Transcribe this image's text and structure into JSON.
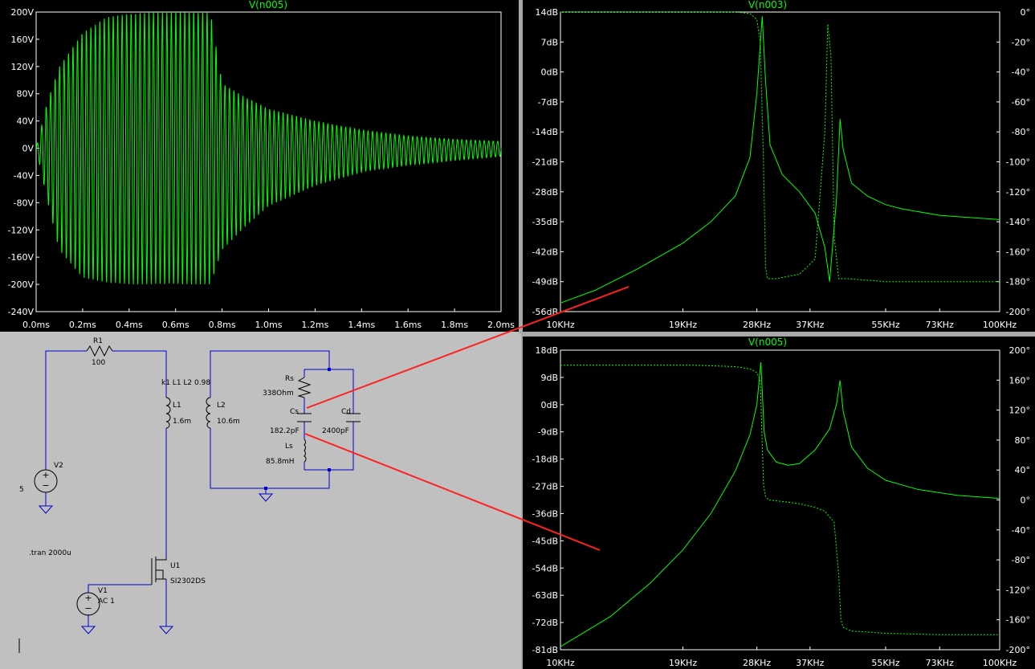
{
  "colors": {
    "trace": "#00ff00",
    "plot_bg": "#000000",
    "axis_text": "#ffffff",
    "grid": "#606060",
    "wire": "#0000cc",
    "schematic_bg": "#c0c0c0",
    "annotation": "#ff2020"
  },
  "plots": {
    "transient": {
      "title": "V(n005)",
      "y_ticks": [
        "200V",
        "160V",
        "120V",
        "80V",
        "40V",
        "0V",
        "-40V",
        "-80V",
        "-120V",
        "-160V",
        "-200V",
        "-240V"
      ],
      "x_ticks": [
        "0.0ms",
        "0.2ms",
        "0.4ms",
        "0.6ms",
        "0.8ms",
        "1.0ms",
        "1.2ms",
        "1.4ms",
        "1.6ms",
        "1.8ms",
        "2.0ms"
      ]
    },
    "ac_top": {
      "title": "V(n003)",
      "y_ticks": [
        "14dB",
        "7dB",
        "0dB",
        "-7dB",
        "-14dB",
        "-21dB",
        "-28dB",
        "-35dB",
        "-42dB",
        "-49dB",
        "-56dB"
      ],
      "y2_ticks": [
        "0°",
        "-20°",
        "-40°",
        "-60°",
        "-80°",
        "-100°",
        "-120°",
        "-140°",
        "-160°",
        "-180°",
        "-200°"
      ],
      "x_ticks": [
        "10KHz",
        "19KHz",
        "28KHz",
        "37KHz",
        "55KHz",
        "73KHz",
        "100KHz"
      ]
    },
    "ac_bottom": {
      "title": "V(n005)",
      "y_ticks": [
        "18dB",
        "9dB",
        "0dB",
        "-9dB",
        "-18dB",
        "-27dB",
        "-36dB",
        "-45dB",
        "-54dB",
        "-63dB",
        "-72dB",
        "-81dB"
      ],
      "y2_ticks": [
        "200°",
        "160°",
        "120°",
        "80°",
        "40°",
        "0°",
        "-40°",
        "-80°",
        "-120°",
        "-160°",
        "-200°"
      ],
      "x_ticks": [
        "10KHz",
        "19KHz",
        "28KHz",
        "37KHz",
        "55KHz",
        "73KHz",
        "100KHz"
      ]
    }
  },
  "chart_data": [
    {
      "type": "line",
      "title": "V(n005)",
      "xlabel": "",
      "ylabel": "",
      "xlim": [
        0.0,
        2.0
      ],
      "x_unit": "ms",
      "ylim": [
        -240,
        200
      ],
      "y_unit": "V",
      "series": [
        {
          "values_note_free": true,
          "x": [
            0.0,
            0.05,
            0.1,
            0.2,
            0.3,
            0.4,
            0.5,
            0.6,
            0.7,
            0.75,
            0.8,
            0.9,
            1.0,
            1.2,
            1.4,
            1.6,
            1.8,
            2.0
          ],
          "envelope_pos": [
            0,
            70,
            120,
            170,
            192,
            198,
            200,
            200,
            200,
            200,
            95,
            75,
            58,
            40,
            27,
            18,
            13,
            10
          ],
          "envelope_neg": [
            0,
            -80,
            -150,
            -190,
            -198,
            -200,
            -200,
            -200,
            -200,
            -200,
            -150,
            -115,
            -85,
            -55,
            -35,
            -25,
            -18,
            -12
          ]
        }
      ]
    },
    {
      "type": "line",
      "title": "V(n003)",
      "xlabel": "",
      "ylabel": "",
      "x_scale": "log",
      "xlim": [
        10,
        100
      ],
      "x_unit": "KHz",
      "ylim": [
        -56,
        14
      ],
      "y_unit": "dB",
      "y2lim": [
        -200,
        0
      ],
      "y2_unit": "°",
      "series": [
        {
          "x": [
            10,
            12,
            15,
            19,
            22,
            25,
            27,
            28,
            28.8,
            29.3,
            30,
            32,
            35,
            38,
            40,
            41,
            42.5,
            43.3,
            44,
            46,
            50,
            55,
            60,
            73,
            85,
            100
          ],
          "values": [
            -54,
            -51,
            -46,
            -40,
            -35,
            -29,
            -20,
            -5,
            13,
            -2,
            -17,
            -24,
            -28,
            -33,
            -41,
            -49,
            -30,
            -11,
            -18,
            -26,
            -29,
            -31,
            -32,
            -33.5,
            -34,
            -34.5
          ]
        },
        {
          "x": [
            10,
            20,
            25,
            27,
            28,
            28.5,
            29,
            29.3,
            29.6,
            31,
            35,
            38,
            40,
            40.6,
            41.3,
            42,
            43,
            45,
            55,
            73,
            100
          ],
          "values": [
            0,
            0,
            0,
            -1,
            -5,
            -20,
            -100,
            -170,
            -178,
            -178,
            -175,
            -165,
            -80,
            -8,
            -30,
            -150,
            -178,
            -178,
            -180,
            -180,
            -180
          ]
        }
      ]
    },
    {
      "type": "line",
      "title": "V(n005)",
      "xlabel": "",
      "ylabel": "",
      "x_scale": "log",
      "xlim": [
        10,
        100
      ],
      "x_unit": "KHz",
      "ylim": [
        -81,
        18
      ],
      "y_unit": "dB",
      "y2lim": [
        -200,
        200
      ],
      "y2_unit": "°",
      "series": [
        {
          "x": [
            10,
            13,
            16,
            19,
            22,
            25,
            27,
            28,
            28.6,
            29.1,
            29.6,
            31,
            33,
            35,
            38,
            41,
            42.5,
            43.3,
            44,
            46,
            50,
            55,
            65,
            80,
            100
          ],
          "values": [
            -80,
            -70,
            -59,
            -48,
            -36,
            -22,
            -10,
            0,
            14,
            -9,
            -15,
            -19,
            -20,
            -19.5,
            -15,
            -8,
            0,
            8,
            -2,
            -14,
            -21,
            -25,
            -28,
            -30,
            -31
          ]
        },
        {
          "x": [
            10,
            20,
            25,
            27,
            28,
            28.5,
            29,
            29.3,
            29.8,
            32,
            35,
            38,
            40,
            42,
            43,
            43.5,
            44,
            46,
            55,
            73,
            100
          ],
          "values": [
            180,
            180,
            178,
            175,
            170,
            160,
            20,
            5,
            0,
            -2,
            -5,
            -10,
            -15,
            -30,
            -100,
            -160,
            -170,
            -175,
            -178,
            -180,
            -180
          ]
        }
      ]
    }
  ],
  "schematic": {
    "r1_name": "R1",
    "r1_value": "100",
    "coupling": "k1 L1 L2 0.98",
    "l1_name": "L1",
    "l1_value": "1.6m",
    "l2_name": "L2",
    "l2_value": "10.6m",
    "rs_name": "Rs",
    "rs_value": "338Ohm",
    "cs_name": "Cs",
    "cs_value": "182.2pF",
    "ls_name": "Ls",
    "ls_value": "85.8mH",
    "cd_name": "Cd",
    "cd_value": "2400pF",
    "v2_name": "V2",
    "v2_value": "5",
    "v1_name": "V1",
    "v1_value": "AC 1",
    "u1_name": "U1",
    "u1_value": "SI2302DS",
    "directive": ".tran 2000u"
  }
}
